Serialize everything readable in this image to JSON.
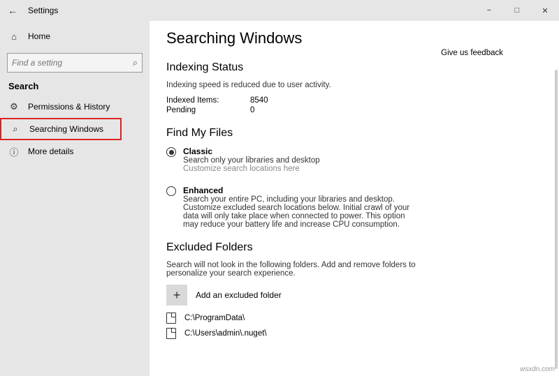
{
  "window": {
    "title": "Settings"
  },
  "sidebar": {
    "home": "Home",
    "search_placeholder": "Find a setting",
    "section": "Search",
    "items": [
      {
        "label": "Permissions & History"
      },
      {
        "label": "Searching Windows"
      },
      {
        "label": "More details"
      }
    ]
  },
  "main": {
    "h1": "Searching Windows",
    "feedback": "Give us feedback",
    "status_h": "Indexing Status",
    "status_desc": "Indexing speed is reduced due to user activity.",
    "indexed_k": "Indexed Items:",
    "indexed_v": "8540",
    "pending_k": "Pending",
    "pending_v": "0",
    "find_h": "Find My Files",
    "classic_t": "Classic",
    "classic_s": "Search only your libraries and desktop",
    "classic_l": "Customize search locations here",
    "enh_t": "Enhanced",
    "enh_s": "Search your entire PC, including your libraries and desktop. Customize excluded search locations below. Initial crawl of your data will only take place when connected to power. This option may reduce your battery life and increase CPU consumption.",
    "excl_h": "Excluded Folders",
    "excl_desc": "Search will not look in the following folders. Add and remove folders to personalize your search experience.",
    "add_label": "Add an excluded folder",
    "folders": [
      "C:\\ProgramData\\",
      "C:\\Users\\admin\\.nuget\\"
    ]
  },
  "watermark": "wsxdn.com"
}
